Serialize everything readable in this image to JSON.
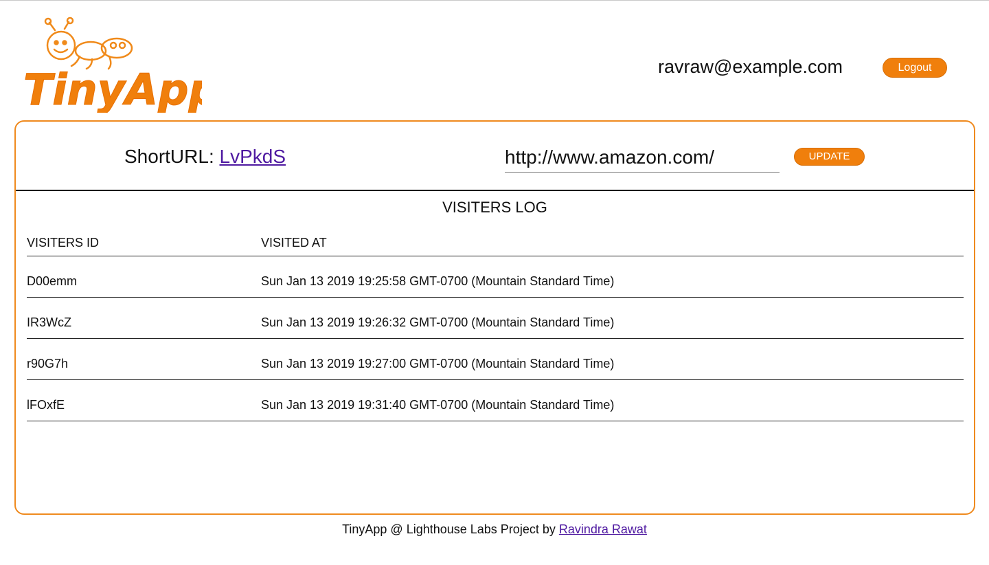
{
  "header": {
    "logo_text": "TinyApp",
    "user_email": "ravraw@example.com",
    "logout_label": "Logout"
  },
  "url_editor": {
    "short_label": "ShortURL:",
    "short_code": "LvPkdS",
    "long_url_value": "http://www.amazon.com/",
    "update_label": "UPDATE"
  },
  "visitors_log": {
    "title": "VISITERS LOG",
    "columns": [
      "VISITERS ID",
      "VISITED AT"
    ],
    "rows": [
      {
        "id": "D00emm",
        "visited_at": "Sun Jan 13 2019 19:25:58 GMT-0700 (Mountain Standard Time)"
      },
      {
        "id": "IR3WcZ",
        "visited_at": "Sun Jan 13 2019 19:26:32 GMT-0700 (Mountain Standard Time)"
      },
      {
        "id": "r90G7h",
        "visited_at": "Sun Jan 13 2019 19:27:00 GMT-0700 (Mountain Standard Time)"
      },
      {
        "id": "lFOxfE",
        "visited_at": "Sun Jan 13 2019 19:31:40 GMT-0700 (Mountain Standard Time)"
      }
    ]
  },
  "footer": {
    "text": "TinyApp @ Lighthouse Labs Project by",
    "author_link": "Ravindra Rawat"
  },
  "colors": {
    "accent": "#f07f0c",
    "link": "#4f1aa1",
    "card_border": "#ef8a1e"
  }
}
